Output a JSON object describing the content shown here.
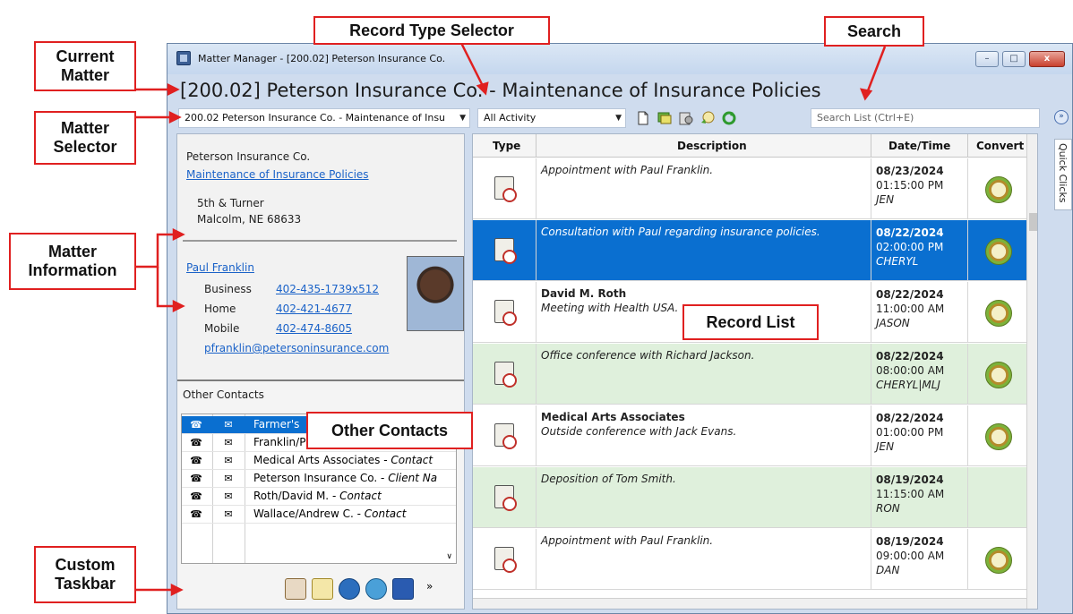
{
  "window": {
    "title": "Matter Manager - [200.02] Peterson Insurance Co.",
    "minimize_glyph": "–",
    "maximize_glyph": "□",
    "close_glyph": "x"
  },
  "matter_title": "[200.02] Peterson Insurance Co. - Maintenance of Insurance Policies",
  "toolbar": {
    "matter_selector_value": "200.02 Peterson Insurance Co. - Maintenance of Insu",
    "record_type_value": "All Activity",
    "search_placeholder": "Search List (Ctrl+E)",
    "icons": [
      "new-document-icon",
      "notes-icon",
      "contacts-icon",
      "convert-icon",
      "refresh-icon"
    ]
  },
  "matter_info": {
    "client": "Peterson Insurance Co.",
    "matter_link": "Maintenance of Insurance Policies",
    "address1": "5th & Turner",
    "address2": "Malcolm, NE  68633",
    "contact_name": "Paul Franklin",
    "phones": [
      {
        "label": "Business",
        "value": "402-435-1739x512"
      },
      {
        "label": "Home",
        "value": "402-421-4677"
      },
      {
        "label": "Mobile",
        "value": "402-474-8605"
      }
    ],
    "email": "pfranklin@petersoninsurance.com"
  },
  "other_contacts": {
    "header": "Other Contacts",
    "phone_glyph": "☎",
    "mail_glyph": "✉",
    "rows": [
      {
        "name": "Farmer's",
        "role": ""
      },
      {
        "name": "Franklin/P",
        "role": ""
      },
      {
        "name": "Medical Arts Associates - ",
        "role": "Contact"
      },
      {
        "name": "Peterson Insurance Co. - ",
        "role": "Client Na"
      },
      {
        "name": "Roth/David M. - ",
        "role": "Contact"
      },
      {
        "name": "Wallace/Andrew C. - ",
        "role": "Contact"
      }
    ]
  },
  "taskbar": {
    "icons": [
      "calendar-icon",
      "notes-icon",
      "timer-icon",
      "globe-icon",
      "word-icon"
    ],
    "overflow_glyph": "»"
  },
  "record_list": {
    "columns": [
      "Type",
      "Description",
      "Date/Time",
      "Convert"
    ],
    "records": [
      {
        "bold": "",
        "desc": "Appointment with Paul Franklin.",
        "date": "08/23/2024",
        "time": "01:15:00 PM",
        "user": "JEN",
        "convert": true,
        "style": "normal"
      },
      {
        "bold": "",
        "desc": "Consultation with Paul regarding insurance policies.",
        "date": "08/22/2024",
        "time": "02:00:00 PM",
        "user": "CHERYL",
        "convert": true,
        "style": "selected"
      },
      {
        "bold": "David M. Roth",
        "desc": "Meeting with Health USA.",
        "date": "08/22/2024",
        "time": "11:00:00 AM",
        "user": "JASON",
        "convert": true,
        "style": "normal"
      },
      {
        "bold": "",
        "desc": "Office conference with Richard Jackson.",
        "date": "08/22/2024",
        "time": "08:00:00 AM",
        "user": "CHERYL|MLJ",
        "convert": true,
        "style": "alt"
      },
      {
        "bold": "Medical Arts Associates",
        "desc": "Outside conference with Jack Evans.",
        "date": "08/22/2024",
        "time": "01:00:00 PM",
        "user": "JEN",
        "convert": true,
        "style": "normal"
      },
      {
        "bold": "",
        "desc": "Deposition of Tom Smith.",
        "date": "08/19/2024",
        "time": "11:15:00 AM",
        "user": "RON",
        "convert": false,
        "style": "alt"
      },
      {
        "bold": "",
        "desc": "Appointment with Paul Franklin.",
        "date": "08/19/2024",
        "time": "09:00:00 AM",
        "user": "DAN",
        "convert": true,
        "style": "normal"
      }
    ]
  },
  "quick_clicks": "Quick Clicks",
  "callouts": {
    "current_matter": "Current\nMatter",
    "matter_selector": "Matter\nSelector",
    "matter_information": "Matter\nInformation",
    "custom_taskbar": "Custom\nTaskbar",
    "record_type_selector": "Record Type Selector",
    "search": "Search",
    "record_list": "Record List",
    "other_contacts": "Other Contacts"
  },
  "colors": {
    "callout_border": "#e02020",
    "selection": "#0a6fd0",
    "alt_row": "#dff0dc",
    "link": "#1a62c8"
  }
}
